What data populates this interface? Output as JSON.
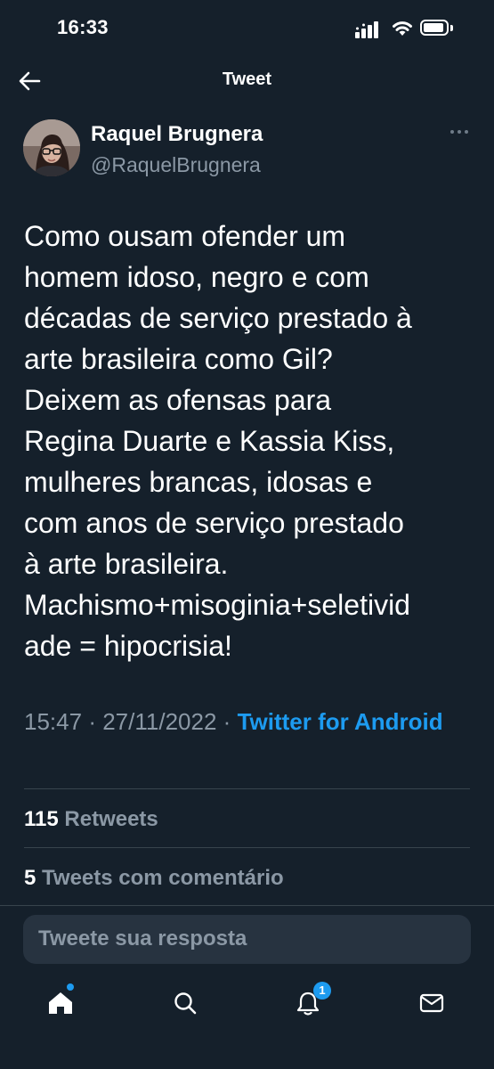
{
  "status_bar": {
    "time": "16:33"
  },
  "header": {
    "title": "Tweet"
  },
  "tweet": {
    "author_name": "Raquel Brugnera",
    "author_handle": "@RaquelBrugnera",
    "text": "Como ousam ofender um\nhomem idoso, negro e com\ndécadas de serviço prestado à\narte brasileira como Gil?\nDeixem as ofensas para\nRegina Duarte e Kassia Kiss,\nmulheres brancas, idosas e\ncom anos de serviço prestado\nà arte brasileira.\nMachismo+misoginia+seletivid\nade =  hipocrisia!",
    "time": "15:47",
    "separator": "·",
    "date": "27/11/2022",
    "source": "Twitter for Android"
  },
  "stats": {
    "retweets_count": "115",
    "retweets_label": "Retweets",
    "quotes_count": "5",
    "quotes_label": "Tweets com comentário"
  },
  "reply": {
    "placeholder": "Tweete sua resposta"
  },
  "tab_bar": {
    "notifications_badge": "1",
    "tabs": [
      "home-icon",
      "search-icon",
      "notifications-icon",
      "messages-icon"
    ]
  },
  "colors": {
    "background": "#15202b",
    "accent": "#1d9bf0",
    "secondary_text": "#8b98a5",
    "divider": "#38444d",
    "input_background": "#273340"
  }
}
